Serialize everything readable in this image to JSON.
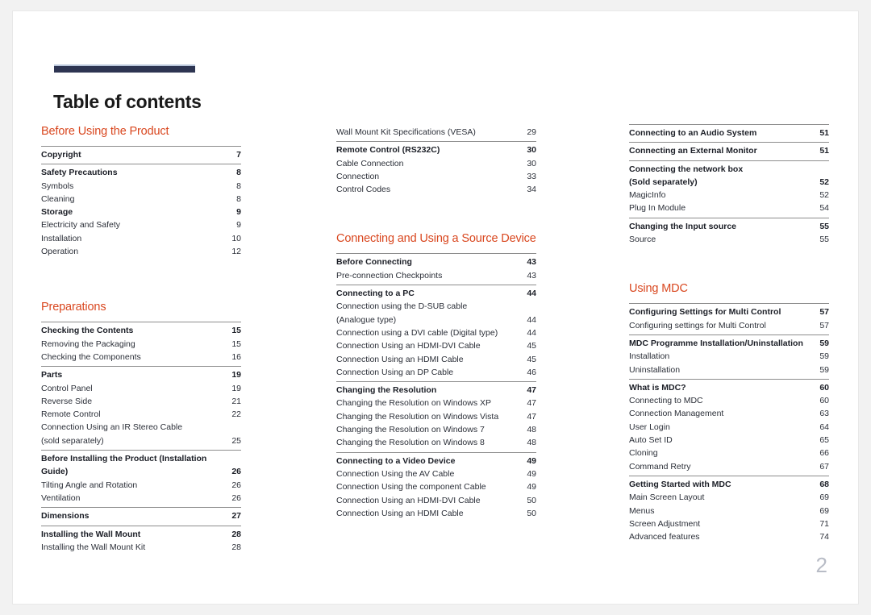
{
  "document": {
    "title": "Table of contents",
    "page_number": "2",
    "accent_heading_color": "#d9471f",
    "title_rule_color": "#2e3552"
  },
  "columns": [
    {
      "id": "column-1",
      "blocks": [
        {
          "type": "section",
          "heading": "Before Using the Product",
          "groups": [
            {
              "entries": [
                {
                  "label": "Copyright",
                  "page": "7",
                  "level": "major"
                }
              ]
            },
            {
              "entries": [
                {
                  "label": "Safety Precautions",
                  "page": "8",
                  "level": "major"
                },
                {
                  "label": "Symbols",
                  "page": "8",
                  "level": "sub"
                },
                {
                  "label": "Cleaning",
                  "page": "8",
                  "level": "sub"
                },
                {
                  "label": "Storage",
                  "page": "9",
                  "level": "major"
                },
                {
                  "label": "Electricity and Safety",
                  "page": "9",
                  "level": "sub"
                },
                {
                  "label": "Installation",
                  "page": "10",
                  "level": "sub"
                },
                {
                  "label": "Operation",
                  "page": "12",
                  "level": "sub"
                }
              ]
            }
          ]
        },
        {
          "type": "section",
          "heading": "Preparations",
          "groups": [
            {
              "entries": [
                {
                  "label": "Checking the Contents",
                  "page": "15",
                  "level": "major"
                },
                {
                  "label": "Removing the Packaging",
                  "page": "15",
                  "level": "sub"
                },
                {
                  "label": "Checking the Components",
                  "page": "16",
                  "level": "sub"
                }
              ]
            },
            {
              "entries": [
                {
                  "label": "Parts",
                  "page": "19",
                  "level": "major"
                },
                {
                  "label": "Control Panel",
                  "page": "19",
                  "level": "sub"
                },
                {
                  "label": "Reverse Side",
                  "page": "21",
                  "level": "sub"
                },
                {
                  "label": "Remote Control",
                  "page": "22",
                  "level": "sub"
                },
                {
                  "label": "Connection Using an IR Stereo Cable\n(sold separately)",
                  "page": "25",
                  "level": "sub"
                }
              ]
            },
            {
              "entries": [
                {
                  "label": "Before Installing the Product (Installation\nGuide)",
                  "page": "26",
                  "level": "major"
                },
                {
                  "label": "Tilting Angle and Rotation",
                  "page": "26",
                  "level": "sub"
                },
                {
                  "label": "Ventilation",
                  "page": "26",
                  "level": "sub"
                }
              ]
            },
            {
              "entries": [
                {
                  "label": "Dimensions",
                  "page": "27",
                  "level": "major"
                }
              ]
            },
            {
              "entries": [
                {
                  "label": "Installing the Wall Mount",
                  "page": "28",
                  "level": "major"
                },
                {
                  "label": "Installing the Wall Mount Kit",
                  "page": "28",
                  "level": "sub"
                }
              ]
            }
          ]
        }
      ]
    },
    {
      "id": "column-2",
      "blocks": [
        {
          "type": "continuation",
          "heading": "",
          "groups": [
            {
              "no_rule": true,
              "entries": [
                {
                  "label": "Wall Mount Kit Specifications (VESA)",
                  "page": "29",
                  "level": "sub"
                }
              ]
            },
            {
              "entries": [
                {
                  "label": "Remote Control (RS232C)",
                  "page": "30",
                  "level": "major"
                },
                {
                  "label": "Cable Connection",
                  "page": "30",
                  "level": "sub"
                },
                {
                  "label": "Connection",
                  "page": "33",
                  "level": "sub"
                },
                {
                  "label": "Control Codes",
                  "page": "34",
                  "level": "sub"
                }
              ]
            }
          ]
        },
        {
          "type": "section",
          "heading": "Connecting and Using a Source Device",
          "groups": [
            {
              "entries": [
                {
                  "label": "Before Connecting",
                  "page": "43",
                  "level": "major"
                },
                {
                  "label": "Pre-connection Checkpoints",
                  "page": "43",
                  "level": "sub"
                }
              ]
            },
            {
              "entries": [
                {
                  "label": "Connecting to a PC",
                  "page": "44",
                  "level": "major"
                },
                {
                  "label": "Connection using the D-SUB cable\n(Analogue type)",
                  "page": "44",
                  "level": "sub"
                },
                {
                  "label": "Connection using a DVI cable (Digital type)",
                  "page": "44",
                  "level": "sub"
                },
                {
                  "label": "Connection Using an HDMI-DVI Cable",
                  "page": "45",
                  "level": "sub"
                },
                {
                  "label": "Connection Using an HDMI Cable",
                  "page": "45",
                  "level": "sub"
                },
                {
                  "label": "Connection Using an DP Cable",
                  "page": "46",
                  "level": "sub"
                }
              ]
            },
            {
              "entries": [
                {
                  "label": "Changing the Resolution",
                  "page": "47",
                  "level": "major"
                },
                {
                  "label": "Changing the Resolution on Windows XP",
                  "page": "47",
                  "level": "sub"
                },
                {
                  "label": "Changing the Resolution on Windows Vista",
                  "page": "47",
                  "level": "sub"
                },
                {
                  "label": "Changing the Resolution on Windows 7",
                  "page": "48",
                  "level": "sub"
                },
                {
                  "label": "Changing the Resolution on Windows 8",
                  "page": "48",
                  "level": "sub"
                }
              ]
            },
            {
              "entries": [
                {
                  "label": "Connecting to a Video Device",
                  "page": "49",
                  "level": "major"
                },
                {
                  "label": "Connection Using the AV Cable",
                  "page": "49",
                  "level": "sub"
                },
                {
                  "label": "Connection Using the component Cable",
                  "page": "49",
                  "level": "sub"
                },
                {
                  "label": "Connection Using an HDMI-DVI Cable",
                  "page": "50",
                  "level": "sub"
                },
                {
                  "label": "Connection Using an HDMI Cable",
                  "page": "50",
                  "level": "sub"
                }
              ]
            }
          ]
        }
      ]
    },
    {
      "id": "column-3",
      "blocks": [
        {
          "type": "continuation",
          "heading": "",
          "groups": [
            {
              "entries": [
                {
                  "label": "Connecting to an Audio System",
                  "page": "51",
                  "level": "major"
                }
              ]
            },
            {
              "entries": [
                {
                  "label": "Connecting an External Monitor",
                  "page": "51",
                  "level": "major"
                }
              ]
            },
            {
              "entries": [
                {
                  "label": "Connecting the network box\n(Sold separately)",
                  "page": "52",
                  "level": "major"
                },
                {
                  "label": "MagicInfo",
                  "page": "52",
                  "level": "sub"
                },
                {
                  "label": "Plug In Module",
                  "page": "54",
                  "level": "sub"
                }
              ]
            },
            {
              "entries": [
                {
                  "label": "Changing the Input source",
                  "page": "55",
                  "level": "major"
                },
                {
                  "label": "Source",
                  "page": "55",
                  "level": "sub"
                }
              ]
            }
          ]
        },
        {
          "type": "section",
          "heading": "Using MDC",
          "groups": [
            {
              "entries": [
                {
                  "label": "Configuring Settings for Multi Control",
                  "page": "57",
                  "level": "major"
                },
                {
                  "label": "Configuring settings for Multi Control",
                  "page": "57",
                  "level": "sub"
                }
              ]
            },
            {
              "entries": [
                {
                  "label": "MDC Programme Installation/Uninstallation",
                  "page": "59",
                  "level": "major"
                },
                {
                  "label": "Installation",
                  "page": "59",
                  "level": "sub"
                },
                {
                  "label": "Uninstallation",
                  "page": "59",
                  "level": "sub"
                }
              ]
            },
            {
              "entries": [
                {
                  "label": "What is MDC?",
                  "page": "60",
                  "level": "major"
                },
                {
                  "label": "Connecting to MDC",
                  "page": "60",
                  "level": "sub"
                },
                {
                  "label": "Connection Management",
                  "page": "63",
                  "level": "sub"
                },
                {
                  "label": "User Login",
                  "page": "64",
                  "level": "sub"
                },
                {
                  "label": "Auto Set ID",
                  "page": "65",
                  "level": "sub"
                },
                {
                  "label": "Cloning",
                  "page": "66",
                  "level": "sub"
                },
                {
                  "label": "Command Retry",
                  "page": "67",
                  "level": "sub"
                }
              ]
            },
            {
              "entries": [
                {
                  "label": "Getting Started with MDC",
                  "page": "68",
                  "level": "major"
                },
                {
                  "label": "Main Screen Layout",
                  "page": "69",
                  "level": "sub"
                },
                {
                  "label": "Menus",
                  "page": "69",
                  "level": "sub"
                },
                {
                  "label": "Screen Adjustment",
                  "page": "71",
                  "level": "sub"
                },
                {
                  "label": "Advanced features",
                  "page": "74",
                  "level": "sub"
                }
              ]
            }
          ]
        }
      ]
    }
  ]
}
